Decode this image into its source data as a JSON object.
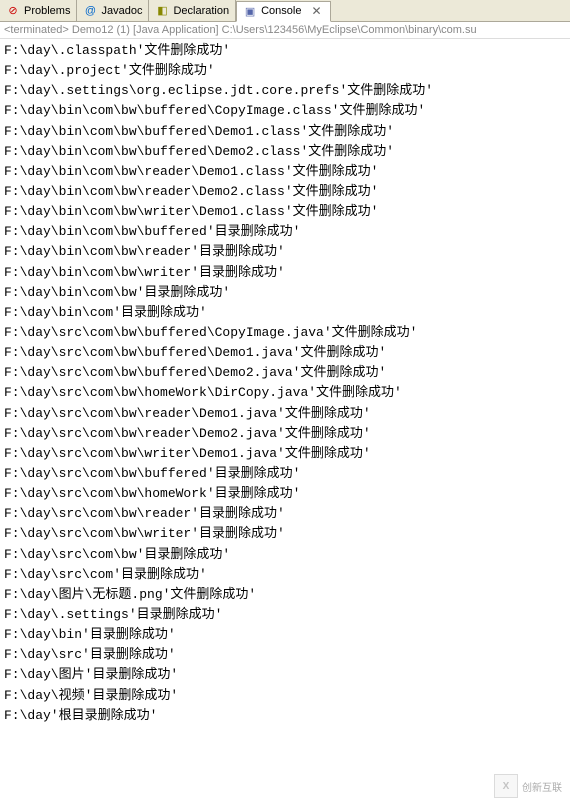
{
  "tabs": [
    {
      "icon": "⊘",
      "cls": "icon-problems",
      "label": "Problems"
    },
    {
      "icon": "@",
      "cls": "icon-javadoc",
      "label": "Javadoc"
    },
    {
      "icon": "◧",
      "cls": "icon-declaration",
      "label": "Declaration"
    },
    {
      "icon": "▣",
      "cls": "icon-console",
      "label": "Console",
      "active": true,
      "closeable": true
    }
  ],
  "status": "<terminated> Demo12 (1) [Java Application] C:\\Users\\123456\\MyEclipse\\Common\\binary\\com.su",
  "lines": [
    "F:\\day\\.classpath'文件删除成功'",
    "F:\\day\\.project'文件删除成功'",
    "F:\\day\\.settings\\org.eclipse.jdt.core.prefs'文件删除成功'",
    "F:\\day\\bin\\com\\bw\\buffered\\CopyImage.class'文件删除成功'",
    "F:\\day\\bin\\com\\bw\\buffered\\Demo1.class'文件删除成功'",
    "F:\\day\\bin\\com\\bw\\buffered\\Demo2.class'文件删除成功'",
    "F:\\day\\bin\\com\\bw\\reader\\Demo1.class'文件删除成功'",
    "F:\\day\\bin\\com\\bw\\reader\\Demo2.class'文件删除成功'",
    "F:\\day\\bin\\com\\bw\\writer\\Demo1.class'文件删除成功'",
    "F:\\day\\bin\\com\\bw\\buffered'目录删除成功'",
    "F:\\day\\bin\\com\\bw\\reader'目录删除成功'",
    "F:\\day\\bin\\com\\bw\\writer'目录删除成功'",
    "F:\\day\\bin\\com\\bw'目录删除成功'",
    "F:\\day\\bin\\com'目录删除成功'",
    "F:\\day\\src\\com\\bw\\buffered\\CopyImage.java'文件删除成功'",
    "F:\\day\\src\\com\\bw\\buffered\\Demo1.java'文件删除成功'",
    "F:\\day\\src\\com\\bw\\buffered\\Demo2.java'文件删除成功'",
    "F:\\day\\src\\com\\bw\\homeWork\\DirCopy.java'文件删除成功'",
    "F:\\day\\src\\com\\bw\\reader\\Demo1.java'文件删除成功'",
    "F:\\day\\src\\com\\bw\\reader\\Demo2.java'文件删除成功'",
    "F:\\day\\src\\com\\bw\\writer\\Demo1.java'文件删除成功'",
    "F:\\day\\src\\com\\bw\\buffered'目录删除成功'",
    "F:\\day\\src\\com\\bw\\homeWork'目录删除成功'",
    "F:\\day\\src\\com\\bw\\reader'目录删除成功'",
    "F:\\day\\src\\com\\bw\\writer'目录删除成功'",
    "F:\\day\\src\\com\\bw'目录删除成功'",
    "F:\\day\\src\\com'目录删除成功'",
    "F:\\day\\图片\\无标题.png'文件删除成功'",
    "F:\\day\\.settings'目录删除成功'",
    "F:\\day\\bin'目录删除成功'",
    "F:\\day\\src'目录删除成功'",
    "F:\\day\\图片'目录删除成功'",
    "F:\\day\\视频'目录删除成功'",
    "F:\\day'根目录删除成功'"
  ],
  "watermark": {
    "logo": "X",
    "text": "创新互联"
  }
}
